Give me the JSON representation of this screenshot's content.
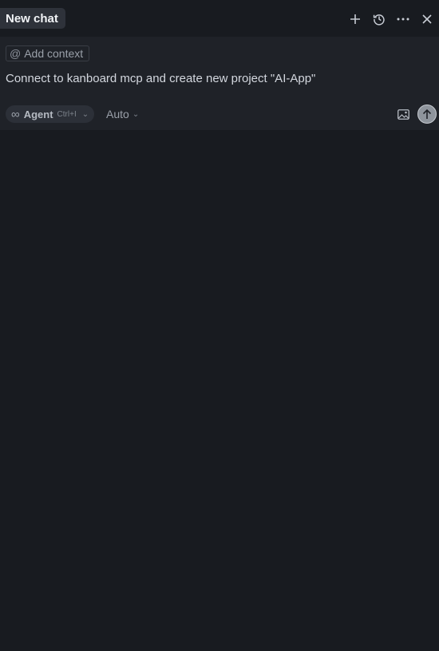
{
  "header": {
    "tab_title": "New chat",
    "actions": [
      {
        "icon": "plus-icon",
        "tooltip": ""
      },
      {
        "icon": "history-icon",
        "tooltip": ""
      },
      {
        "icon": "more-icon",
        "tooltip": ""
      },
      {
        "icon": "close-icon",
        "tooltip": ""
      }
    ]
  },
  "composer": {
    "context_chip": {
      "icon": "at-icon",
      "label": "Add context"
    },
    "message": "Connect to kanboard mcp and create new project \"AI-App\"",
    "mode": {
      "icon": "infinity-icon",
      "label": "Agent",
      "shortcut": "Ctrl+I"
    },
    "model": {
      "label": "Auto"
    },
    "image_icon": "image-icon",
    "send_icon": "arrow-up-icon"
  },
  "colors": {
    "background": "#181b20",
    "composer_bg": "#1f2228",
    "tab_bg": "#2e323a",
    "pill_bg": "#2c3038",
    "send_bg": "#8e949c"
  }
}
